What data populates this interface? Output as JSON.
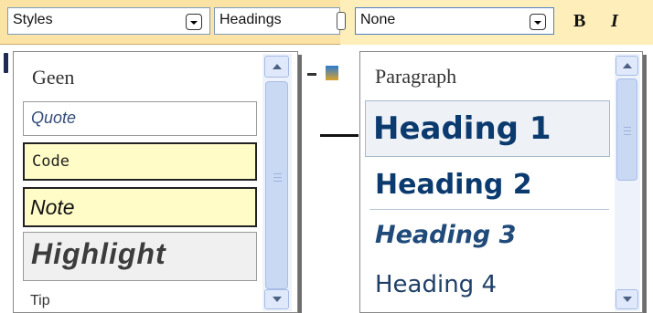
{
  "toolbar": {
    "styles_combo": "Styles",
    "headings_combo": "Headings",
    "format_combo": "None",
    "bold": "B",
    "italic": "I"
  },
  "styles_menu": {
    "items": [
      "Geen",
      "Quote",
      "Code",
      "Note",
      "Highlight",
      "Tip"
    ]
  },
  "headings_menu": {
    "items": [
      "Paragraph",
      "Heading 1",
      "Heading 2",
      "Heading 3",
      "Heading 4"
    ]
  },
  "colors": {
    "toolbar_bg": "#fdeeba",
    "heading_blue": "#0b3a6f",
    "highlight_bg": "#fffcc8"
  }
}
